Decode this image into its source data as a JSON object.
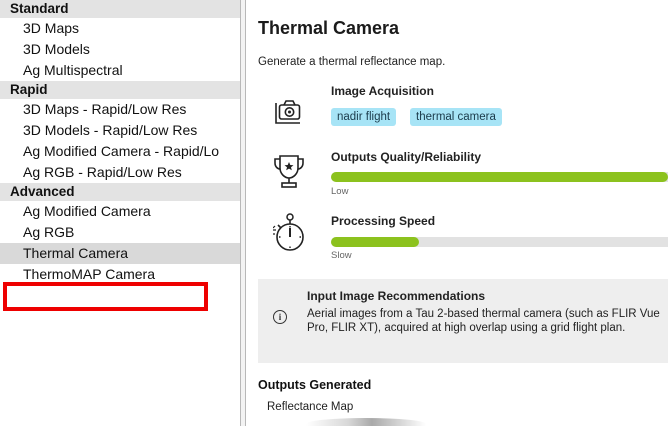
{
  "sidebar": {
    "groups": [
      {
        "header": "Standard",
        "items": [
          "3D Maps",
          "3D Models",
          "Ag Multispectral"
        ]
      },
      {
        "header": "Rapid",
        "items": [
          "3D Maps - Rapid/Low Res",
          "3D Models - Rapid/Low Res",
          "Ag Modified Camera - Rapid/Lo",
          "Ag RGB - Rapid/Low Res"
        ]
      },
      {
        "header": "Advanced",
        "items": [
          "Ag Modified Camera",
          "Ag RGB",
          "Thermal Camera",
          "ThermoMAP Camera"
        ]
      }
    ],
    "selected_item": "Thermal Camera"
  },
  "detail": {
    "title": "Thermal Camera",
    "description": "Generate a thermal reflectance map.",
    "image_acquisition": {
      "label": "Image Acquisition",
      "icon": "camera-icon",
      "tags": [
        "nadir flight",
        "thermal camera"
      ]
    },
    "quality": {
      "label": "Outputs Quality/Reliability",
      "icon": "trophy-icon",
      "level": 1.0,
      "caption": "Low"
    },
    "speed": {
      "label": "Processing Speed",
      "icon": "stopwatch-icon",
      "level": 0.26,
      "caption": "Slow"
    },
    "recommendations": {
      "title": "Input Image Recommendations",
      "text": "Aerial images from a Tau 2-based thermal camera (such as FLIR Vue Pro, FLIR XT), acquired at high overlap using a grid flight plan.",
      "icon": "info-icon"
    },
    "outputs": {
      "heading": "Outputs Generated",
      "items": [
        "Reflectance Map"
      ]
    }
  },
  "colors": {
    "bar_fill": "#8cc21e",
    "tag_bg": "#a7e4f6",
    "group_header_bg": "#e3e3e3",
    "selected_bg": "#d9d9d9",
    "highlight_border": "#ee0000"
  }
}
